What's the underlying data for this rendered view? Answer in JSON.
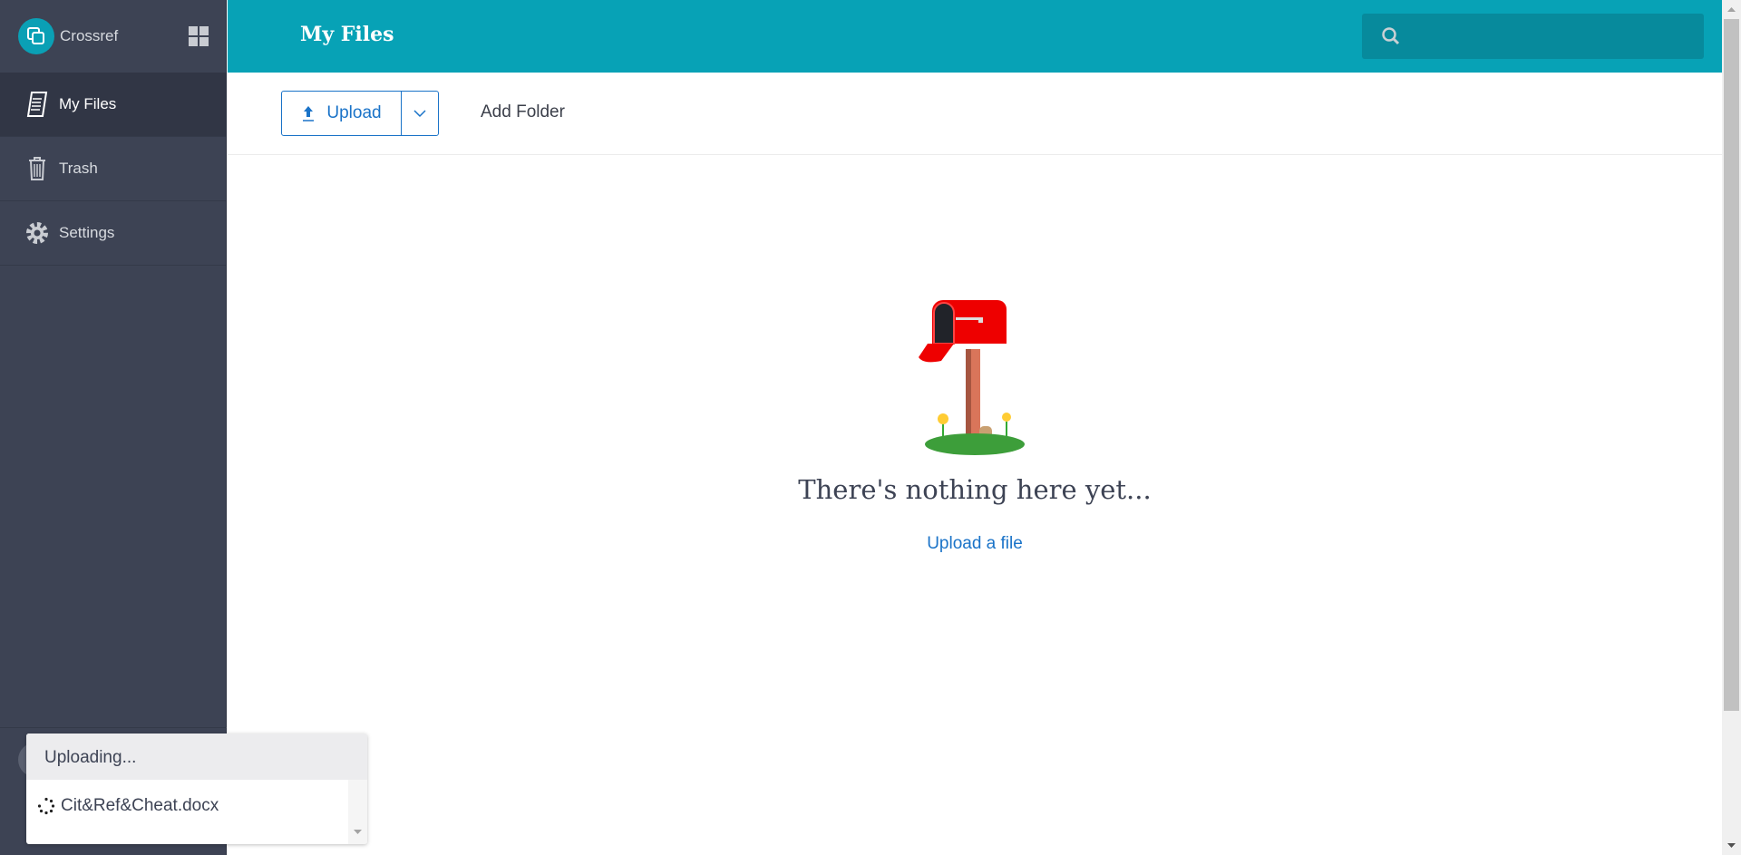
{
  "sidebar": {
    "brand": "Crossref",
    "items": [
      {
        "label": "My Files",
        "icon": "files-icon",
        "active": true
      },
      {
        "label": "Trash",
        "icon": "trash-icon"
      },
      {
        "label": "Settings",
        "icon": "gear-icon"
      }
    ]
  },
  "header": {
    "title": "My Files",
    "search_placeholder": ""
  },
  "toolbar": {
    "upload_label": "Upload",
    "add_folder_label": "Add Folder"
  },
  "empty": {
    "message": "There's nothing here yet...",
    "link": "Upload a file"
  },
  "upload_popup": {
    "title": "Uploading...",
    "file": "Cit&Ref&Cheat.docx"
  },
  "colors": {
    "accent": "#07a2b6",
    "sidebar": "#3d4354",
    "link": "#1a73c8"
  }
}
